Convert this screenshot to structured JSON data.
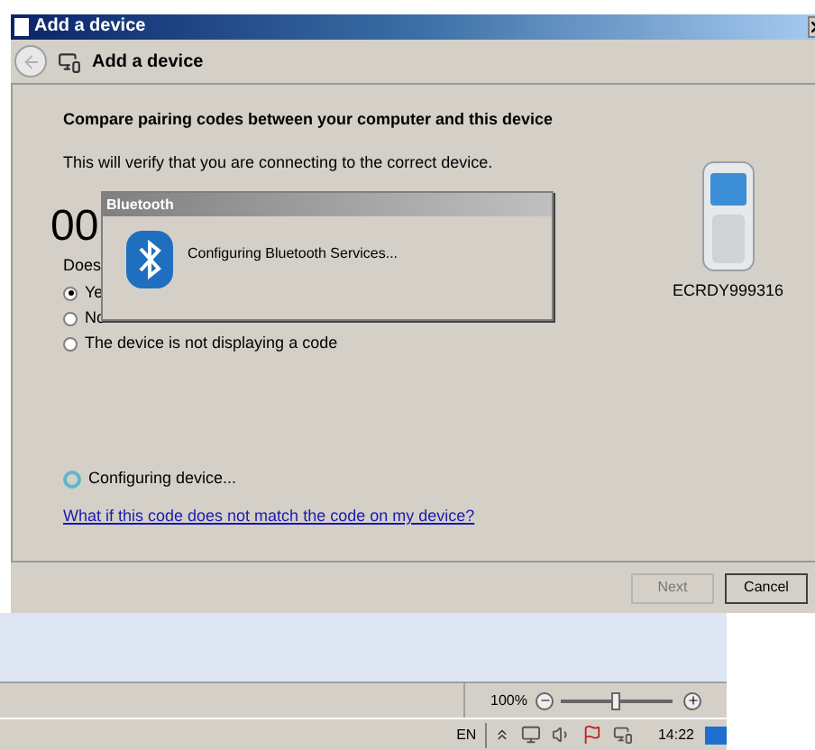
{
  "window": {
    "title": "Add a device"
  },
  "nav": {
    "title": "Add a device"
  },
  "content": {
    "heading": "Compare pairing codes between your computer and this device",
    "subtitle": "This will verify that you are connecting to the correct device.",
    "code": "00",
    "question": "Does",
    "options": [
      {
        "label": "Ye",
        "selected": true
      },
      {
        "label": "No",
        "selected": false
      },
      {
        "label": "The device is not displaying a code",
        "selected": false
      }
    ],
    "device_name": "ECRDY999316",
    "progress_text": "Configuring device...",
    "help_link": "What if this code does not match the code on my device?"
  },
  "popup": {
    "title": "Bluetooth",
    "message": "Configuring Bluetooth Services..."
  },
  "buttons": [
    {
      "label": "Next",
      "disabled": true
    },
    {
      "label": "Cancel",
      "disabled": false
    }
  ],
  "status_bar": {
    "zoom": "100%",
    "zoom_slider": {
      "level": 0.48
    }
  },
  "taskbar": {
    "language": "EN",
    "time": "14:22"
  }
}
